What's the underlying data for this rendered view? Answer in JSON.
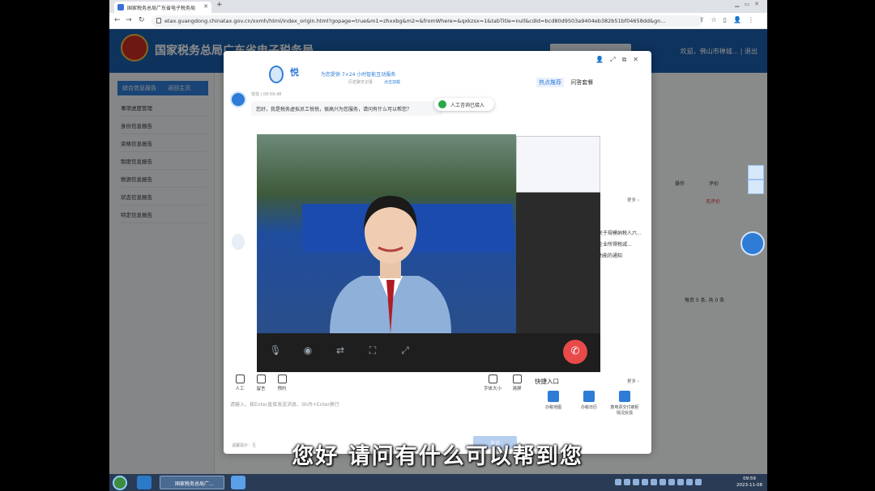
{
  "browser": {
    "tab_title": "国家税务总局广东省电子税务局",
    "url": "etax.guangdong.chinatax.gov.cn/xxmh/html/index_origin.html?gopage=true&m1=zhxxbg&m2=&fromWhere=&qxkzsx=1&tabTitle=null&cdId=bcd80d9503a9404eb382b51bf04658dd&gn..."
  },
  "site": {
    "title": "国家税务总局广东省电子税务局",
    "user": "欢迎，佛山市禅城...",
    "logout": "退出",
    "sidebar_header": "综合信息报告",
    "sidebar_back": "返回主页",
    "sidebar_items": [
      "事项进度管理",
      "身份信息报告",
      "资格信息报告",
      "制度信息报告",
      "税源信息报告",
      "状态信息报告",
      "特定信息报告"
    ]
  },
  "chat": {
    "brand": "悦",
    "slogan": "为您提供 7×24 小时智能互动服务",
    "history": "历史聊天记录",
    "click_load": "点击加载",
    "tab_hot": "热点推荐",
    "tab_faq": "问答套餐",
    "bot_meta": "悦悦 | 09:59:48",
    "greeting": "您好，我是税务虚拟员工悦悦，很高兴为您服务，请问有什么可以帮您？",
    "toast": "人工咨询已接入",
    "right_items": [
      "关于规模纳税人六...",
      "企业所得税减...",
      "功能的通知"
    ],
    "more": "更多 ›",
    "tools": [
      {
        "label": "人工"
      },
      {
        "label": "留言"
      },
      {
        "label": "预约"
      }
    ],
    "tools_right": [
      {
        "label": "字体大小"
      },
      {
        "label": "清屏"
      }
    ],
    "quick_title": "快捷入口",
    "quick_items": [
      "办税地图",
      "办税日历",
      "数电票交付被拒情况反馈"
    ],
    "input_placeholder": "请输入，按Enter直接发送消息，Shift+Enter换行",
    "send": "发送",
    "footer_hint": "温馨提示：互"
  },
  "page_right": {
    "col_op": "操作",
    "col_eval": "评价",
    "no_eval": "无评价",
    "pager": "每页 5 条, 共 0 条"
  },
  "taskbar": {
    "task_label": "国家税务总局广...",
    "time": "09:59",
    "date": "2023-11-08"
  },
  "subtitle": "您好 请问有什么可以帮到您",
  "colors": {
    "accent": "#2f7cd6",
    "hangup": "#e84a4a",
    "header": "#1b5eaa"
  }
}
